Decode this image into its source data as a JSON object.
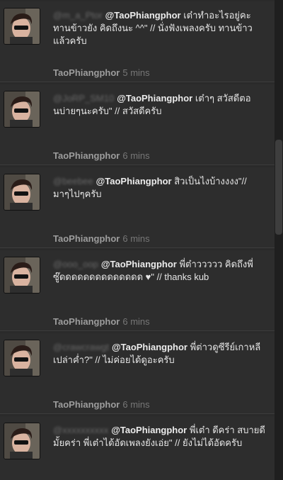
{
  "timeline": {
    "tweets": [
      {
        "handle_blurred": "@m_a_Ptor",
        "mention": "@TaoPhiangphor",
        "text": "เต๋าทำอะไรอยู่คะ ทานข้าวยัง คิดถึงนะ ^^\" // นั่งฟังเพลงครับ ทานข้าวแล้วครับ",
        "author": "TaoPhiangphor",
        "time": "5 mins"
      },
      {
        "handle_blurred": "@JoRP_SM10",
        "mention": "@TaoPhiangphor",
        "text": "เต๋าๆ สวัสดีตอนบ่ายๆนะครับ\" // สวัสดีครับ",
        "author": "TaoPhiangphor",
        "time": "6 mins"
      },
      {
        "handle_blurred": "@beebee",
        "mention": "@TaoPhiangphor",
        "text": "สิวเป็นไงบ้างงงง\"// มาๆไปๆครับ",
        "author": "TaoPhiangphor",
        "time": "6 mins"
      },
      {
        "handle_blurred": "@ooo_oop",
        "mention": "@TaoPhiangphor",
        "text": "พี่ต๋าววววว คิดถึงพี่ซู๊ดดดดดดดดดดดดดด ♥\" // thanks kub",
        "author": "TaoPhiangphor",
        "time": "6 mins"
      },
      {
        "handle_blurred": "@crawcrawgt",
        "mention": "@TaoPhiangphor",
        "text": "พี่ต่าวดูซีรีย์เกาหลีเปล่าค่ำ?\" // ไม่ค่อยได้ดูอะครับ",
        "author": "TaoPhiangphor",
        "time": "6 mins"
      },
      {
        "handle_blurred": "@xxxxxxxxxx",
        "mention": "@TaoPhiangphor",
        "text": "พี่เต๋า ดีคร่า สบายดีมั้ยคร่า พี่เต๋าได้อัดเพลงยังเอ่ย\" // ยังไม่ได้อัดครับ",
        "author": "",
        "time": ""
      }
    ]
  }
}
